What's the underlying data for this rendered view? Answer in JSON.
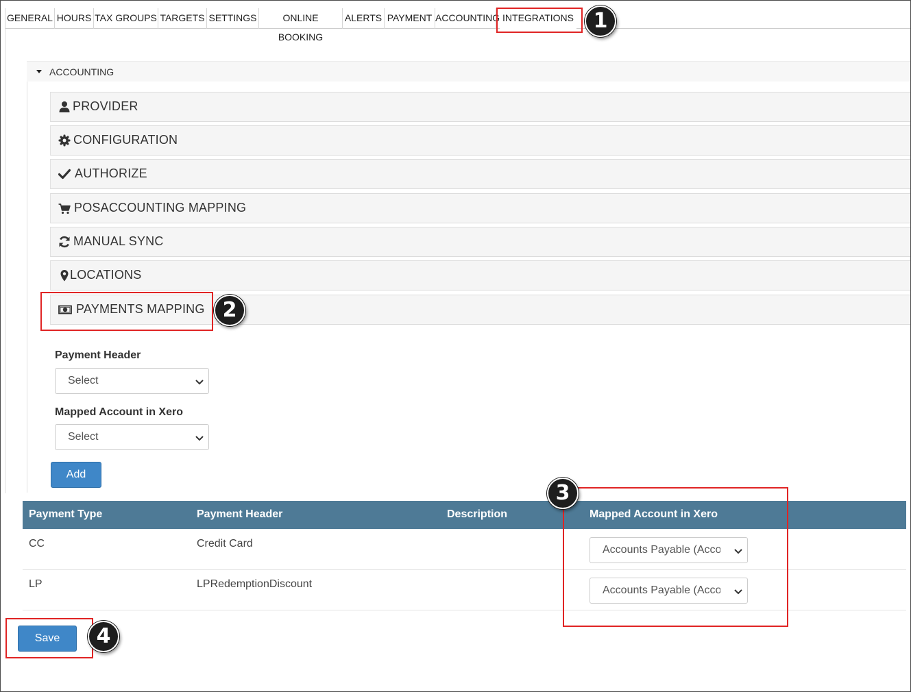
{
  "tabs": [
    {
      "label": "GENERAL"
    },
    {
      "label": "HOURS"
    },
    {
      "label": "TAX GROUPS"
    },
    {
      "label": "TARGETS"
    },
    {
      "label": "SETTINGS"
    },
    {
      "label": "ONLINE BOOKING"
    },
    {
      "label": "ALERTS"
    },
    {
      "label": "PAYMENT"
    },
    {
      "label": "ACCOUNTING"
    },
    {
      "label": "INTEGRATIONS",
      "active": true
    }
  ],
  "accounting": {
    "title": "ACCOUNTING",
    "panels": [
      {
        "label": "PROVIDER",
        "icon": "user-icon"
      },
      {
        "label": "CONFIGURATION",
        "icon": "gear-icon"
      },
      {
        "label": "AUTHORIZE",
        "icon": "check-icon"
      },
      {
        "label": "POSACCOUNTING MAPPING",
        "icon": "cart-icon"
      },
      {
        "label": "MANUAL SYNC",
        "icon": "refresh-icon"
      },
      {
        "label": "LOCATIONS",
        "icon": "map-marker-icon"
      },
      {
        "label": "PAYMENTS MAPPING",
        "icon": "money-icon"
      }
    ]
  },
  "form": {
    "payment_header_label": "Payment Header",
    "payment_header_value": "Select",
    "mapped_account_label": "Mapped Account in Xero",
    "mapped_account_value": "Select",
    "add_label": "Add"
  },
  "table": {
    "headers": [
      "Payment Type",
      "Payment Header",
      "Description",
      "Mapped Account in Xero"
    ],
    "rows": [
      {
        "type": "CC",
        "header": "Credit Card",
        "description": "",
        "mapped": "Accounts Payable (Accounts Payable)"
      },
      {
        "type": "LP",
        "header": "LPRedemptionDiscount",
        "description": "",
        "mapped": "Accounts Payable (Accounts Payable)"
      }
    ]
  },
  "save_label": "Save",
  "callouts": [
    "1",
    "2",
    "3",
    "4"
  ],
  "colors": {
    "table_header": "#4e7a96",
    "button": "#3f87c8",
    "highlight": "#e02424",
    "badge": "#1e1e1e"
  }
}
